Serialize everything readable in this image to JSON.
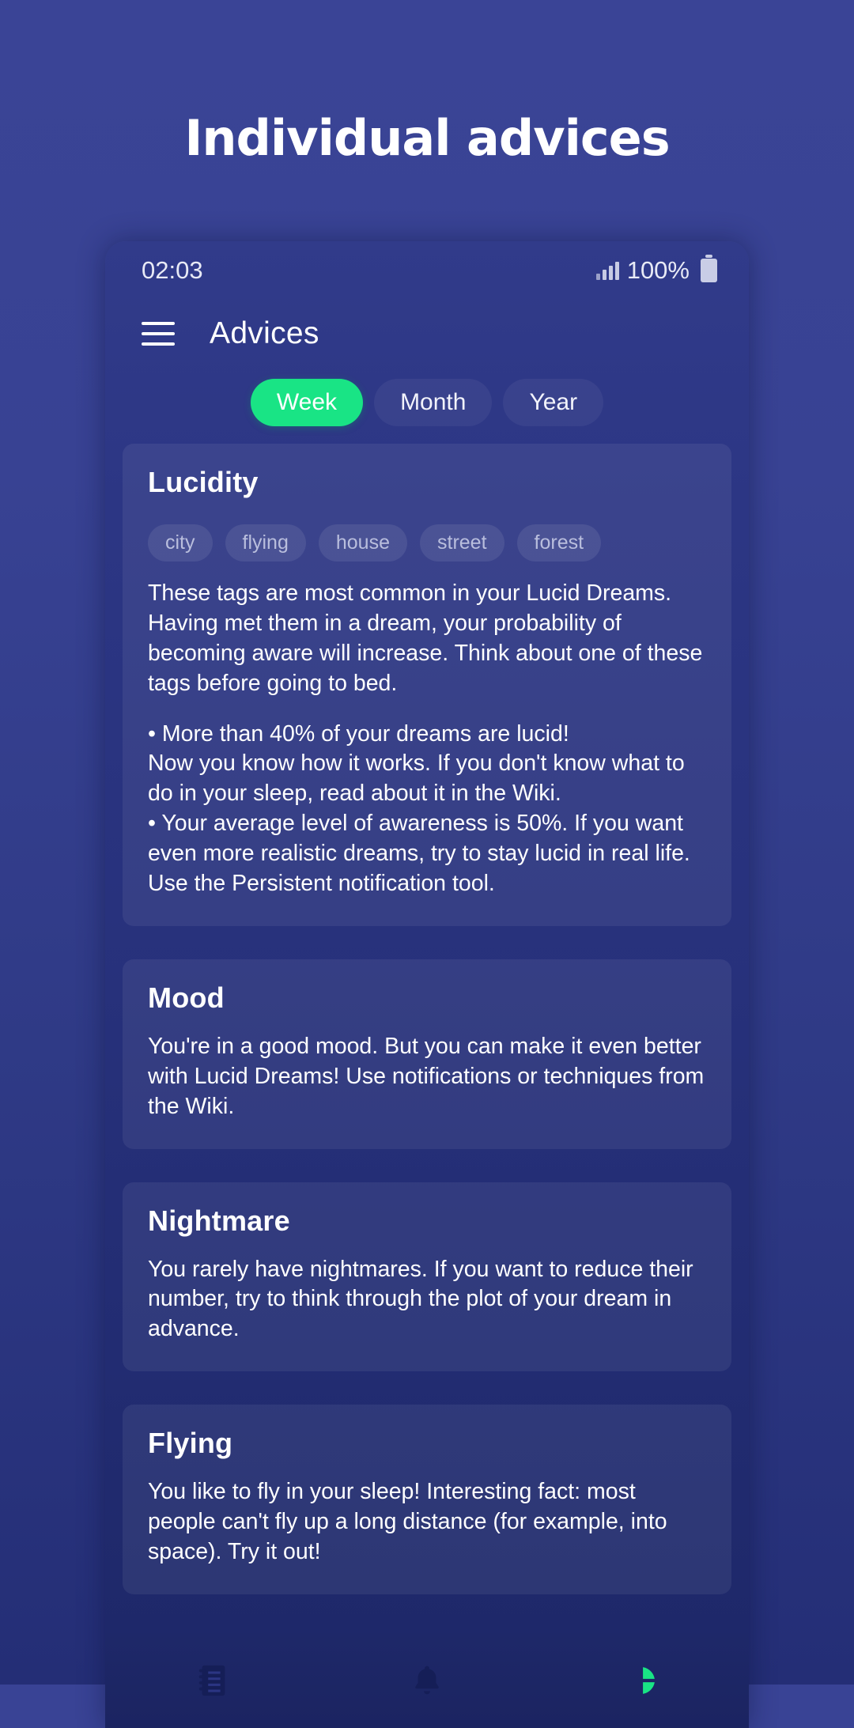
{
  "promo": {
    "title": "Individual advices"
  },
  "colors": {
    "background": "#394395",
    "phone_bg": "#2b3583",
    "accent_green": "#19e485",
    "card_bg": "rgba(255,255,255,0.065)",
    "nav_bg": "#1e2869"
  },
  "statusbar": {
    "time": "02:03",
    "battery_percent": "100%",
    "signal_icon": "signal-bars-icon",
    "battery_icon": "battery-full-icon"
  },
  "appbar": {
    "menu_icon": "hamburger-menu-icon",
    "title": "Advices"
  },
  "segments": [
    {
      "label": "Week",
      "active": true
    },
    {
      "label": "Month",
      "active": false
    },
    {
      "label": "Year",
      "active": false
    }
  ],
  "cards": [
    {
      "title": "Lucidity",
      "tags": [
        "city",
        "flying",
        "house",
        "street",
        "forest"
      ],
      "paragraphs": [
        "These tags are most common in your Lucid Dreams. Having met them in a dream, your probability of becoming aware will increase. Think about one of these tags before going to bed.",
        "• More than 40% of your dreams are lucid!\nNow you know how it works. If you don't know what to do in your sleep, read about it in the Wiki.\n• Your average level of awareness is 50%. If you want even more realistic dreams, try to stay lucid in real life. Use the Persistent notification tool."
      ]
    },
    {
      "title": "Mood",
      "tags": [],
      "paragraphs": [
        "You're in a good mood. But you can make it even better with Lucid Dreams! Use notifications or techniques from the Wiki."
      ]
    },
    {
      "title": "Nightmare",
      "tags": [],
      "paragraphs": [
        "You rarely have nightmares. If you want to reduce their number, try to think through the plot of your dream in advance."
      ]
    },
    {
      "title": "Flying",
      "tags": [],
      "paragraphs": [
        "You like to fly in your sleep! Interesting fact: most people can't fly up a long distance (for example, into space). Try it out!"
      ]
    }
  ],
  "bottomnav": [
    {
      "icon": "journal-icon",
      "active": false
    },
    {
      "icon": "bell-icon",
      "active": false
    },
    {
      "icon": "pie-chart-icon",
      "active": true
    }
  ]
}
